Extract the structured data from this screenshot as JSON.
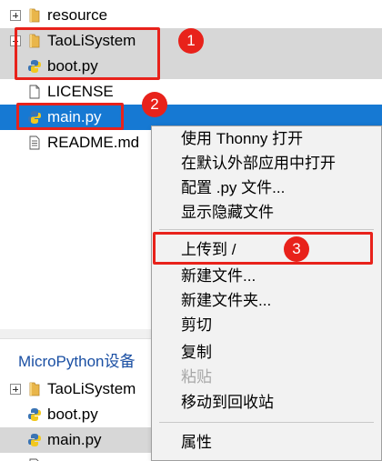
{
  "tree": {
    "resource_label": "resource",
    "taolisystem_label": "TaoLiSystem",
    "boot_label": "boot.py",
    "license_label": "LICENSE",
    "main_label": "main.py",
    "readme_label": "README.md"
  },
  "panel": {
    "title": "MicroPython设备"
  },
  "device_tree": {
    "taolisystem_label": "TaoLiSystem",
    "boot_label": "boot.py",
    "main_label": "main.py"
  },
  "annotations": {
    "badge1": "1",
    "badge2": "2",
    "badge3": "3"
  },
  "context_menu": {
    "open_thonny": "使用 Thonny 打开",
    "open_default": "在默认外部应用中打开",
    "configure_py": "配置 .py 文件...",
    "show_hidden": "显示隐藏文件",
    "upload_to": "上传到 /",
    "new_file": "新建文件...",
    "new_folder": "新建文件夹...",
    "cut": "剪切",
    "copy": "复制",
    "paste": "粘贴",
    "move_to_trash": "移动到回收站",
    "properties": "属性"
  },
  "colors": {
    "selection": "#1679d3",
    "highlight_gray": "#d7d7d7",
    "annotation_red": "#e8221b",
    "panel_title": "#1a4fa3"
  },
  "icons": {
    "folder": "folder-icon",
    "python_file": "python-file-icon",
    "text_file": "file-icon",
    "document_file": "document-file-icon",
    "expander": "expand-plus-icon"
  }
}
